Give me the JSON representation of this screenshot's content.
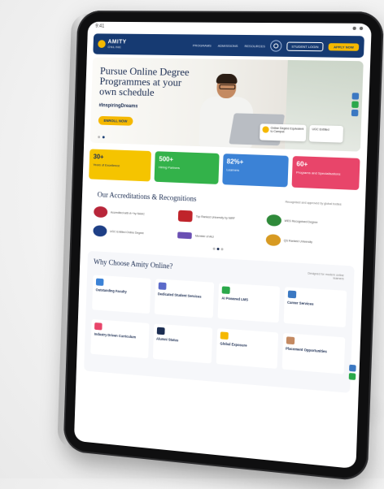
{
  "brand": {
    "name": "AMITY",
    "subtitle": "ONLINE",
    "accent": "#f5b800",
    "navy": "#163a72"
  },
  "nav": {
    "links": [
      "PROGRAMS",
      "ADMISSIONS",
      "RESOURCES"
    ],
    "login_label": "STUDENT LOGIN",
    "apply_label": "APPLY NOW"
  },
  "hero": {
    "title": "Pursue Online Degree Programmes at your own schedule",
    "hashtag": "#InspiringDreams",
    "cta": "ENROLL NOW",
    "badge_text": "Online Degree Equivalent to Campus",
    "badge2_text": "UGC Entitled"
  },
  "stats": [
    {
      "num": "30+",
      "label": "Years of Excellence"
    },
    {
      "num": "500+",
      "label": "Hiring Partners"
    },
    {
      "num": "82%+",
      "label": "Learners"
    },
    {
      "num": "60+",
      "label": "Programs and Specialisations"
    }
  ],
  "accreditations": {
    "title": "Our Accreditations & Recognitions",
    "side_note": "Recognised and approved by global bodies",
    "items": [
      {
        "text": "Accredited with A+ by NAAC",
        "color": "#b8263a"
      },
      {
        "text": "Top Ranked University by NIRF",
        "color": "#c0242b"
      },
      {
        "text": "WES Recognised Degree",
        "color": "#2f8a3a"
      },
      {
        "text": "UGC Entitled Online Degree",
        "color": "#1e3f86"
      },
      {
        "text": "Member of AIU",
        "color": "#6a4fb3"
      },
      {
        "text": "QS Ranked University",
        "color": "#d79a22"
      }
    ]
  },
  "why": {
    "title": "Why Choose Amity Online?",
    "subtitle": "Designed for modern online learners",
    "items": [
      {
        "name": "Outstanding Faculty",
        "icon_color": "#3b82d6"
      },
      {
        "name": "Dedicated Student Services",
        "icon_color": "#5b6ac9"
      },
      {
        "name": "AI Powered LMS",
        "icon_color": "#2aa84a"
      },
      {
        "name": "Career Services",
        "icon_color": "#3b78c2"
      },
      {
        "name": "Industry Driven Curriculum",
        "icon_color": "#e8456a"
      },
      {
        "name": "Alumni Status",
        "icon_color": "#1b2d52"
      },
      {
        "name": "Global Exposure",
        "icon_color": "#f5b800"
      },
      {
        "name": "Placement Opportunities",
        "icon_color": "#c48a62"
      }
    ]
  }
}
